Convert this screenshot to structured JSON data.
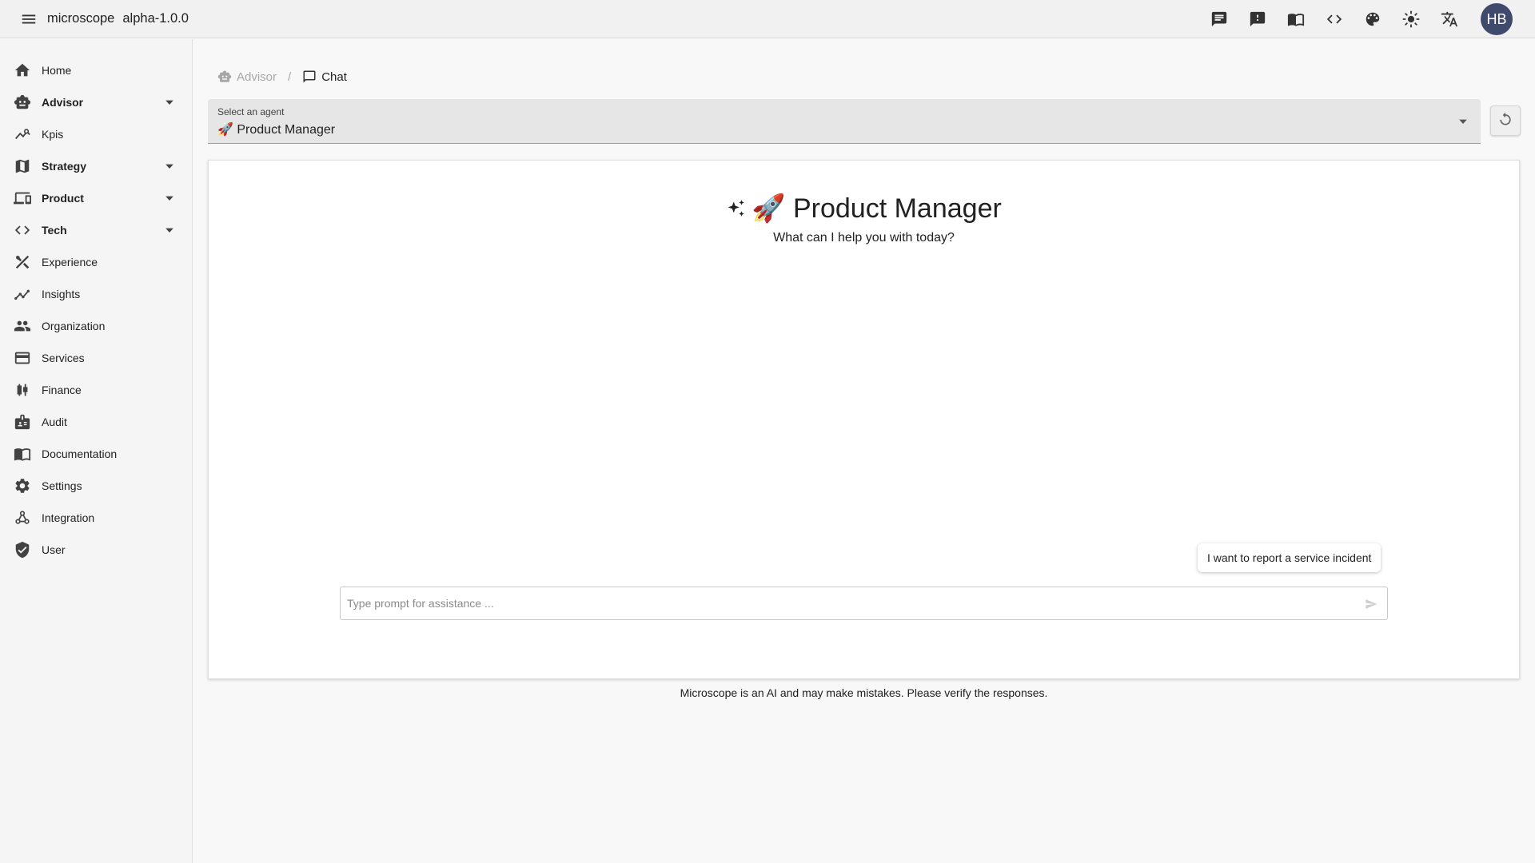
{
  "app": {
    "title": "microscope",
    "version": "alpha-1.0.0",
    "user_initials": "HB",
    "accent_color": "#3f4a6d"
  },
  "header_icons": [
    "chat-icon",
    "feedback-icon",
    "docs-book-icon",
    "code-icon",
    "palette-icon",
    "light-mode-icon",
    "translate-icon"
  ],
  "sidebar": {
    "items": [
      {
        "label": "Home",
        "icon": "home-icon",
        "expandable": false,
        "bold": false
      },
      {
        "label": "Advisor",
        "icon": "robot-icon",
        "expandable": true,
        "bold": true
      },
      {
        "label": "Kpis",
        "icon": "query-stats-icon",
        "expandable": false,
        "bold": false
      },
      {
        "label": "Strategy",
        "icon": "map-icon",
        "expandable": true,
        "bold": true
      },
      {
        "label": "Product",
        "icon": "devices-icon",
        "expandable": true,
        "bold": true
      },
      {
        "label": "Tech",
        "icon": "code-icon",
        "expandable": true,
        "bold": true
      },
      {
        "label": "Experience",
        "icon": "design-tools-icon",
        "expandable": false,
        "bold": false
      },
      {
        "label": "Insights",
        "icon": "insights-icon",
        "expandable": false,
        "bold": false
      },
      {
        "label": "Organization",
        "icon": "people-icon",
        "expandable": false,
        "bold": false
      },
      {
        "label": "Services",
        "icon": "card-icon",
        "expandable": false,
        "bold": false
      },
      {
        "label": "Finance",
        "icon": "candlestick-icon",
        "expandable": false,
        "bold": false
      },
      {
        "label": "Audit",
        "icon": "badge-icon",
        "expandable": false,
        "bold": false
      },
      {
        "label": "Documentation",
        "icon": "book-icon",
        "expandable": false,
        "bold": false
      },
      {
        "label": "Settings",
        "icon": "gear-icon",
        "expandable": false,
        "bold": false
      },
      {
        "label": "Integration",
        "icon": "webhook-icon",
        "expandable": false,
        "bold": false
      },
      {
        "label": "User",
        "icon": "verified-user-icon",
        "expandable": false,
        "bold": false
      }
    ]
  },
  "breadcrumb": {
    "parent": "Advisor",
    "current": "Chat"
  },
  "agent_select": {
    "label": "Select an agent",
    "value": "🚀 Product Manager"
  },
  "chat": {
    "heading": "🚀 Product Manager",
    "subheading": "What can I help you with today?",
    "suggestion": "I want to report a service incident",
    "prompt_placeholder": "Type prompt for assistance ...",
    "prompt_value": ""
  },
  "disclaimer": "Microscope is an AI and may make mistakes. Please verify the responses."
}
